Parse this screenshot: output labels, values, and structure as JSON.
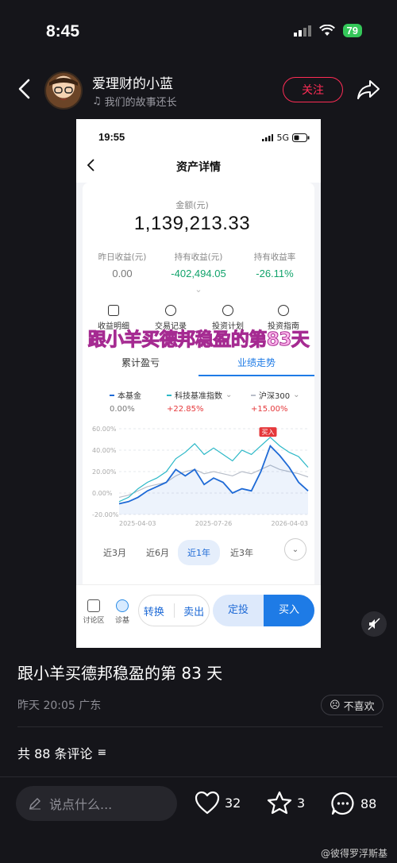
{
  "status": {
    "time": "8:45",
    "battery": "79"
  },
  "header": {
    "author": "爱理财的小蓝",
    "music": "我们的故事还长",
    "follow_label": "关注"
  },
  "screenshot": {
    "status_time": "19:55",
    "network": "5G",
    "title": "资产详情",
    "amount_label": "金额(元)",
    "amount_value": "1,139,213.33",
    "stats": [
      {
        "label": "昨日收益(元)",
        "value": "0.00"
      },
      {
        "label": "持有收益(元)",
        "value": "-402,494.05"
      },
      {
        "label": "持有收益率",
        "value": "-26.11%"
      }
    ],
    "tools": [
      "收益明细",
      "交易记录",
      "投资计划",
      "投资指南"
    ],
    "watermark": "跟小羊买德邦稳盈的第83天",
    "tabs": [
      "累计盈亏",
      "业绩走势"
    ],
    "legend": [
      {
        "name": "本基金",
        "pct": "0.00%",
        "color": "#1e6ad6"
      },
      {
        "name": "科技基准指数",
        "pct": "+22.85%",
        "color": "#2bb8c7"
      },
      {
        "name": "沪深300",
        "pct": "+15.00%",
        "color": "#b8bec9"
      }
    ],
    "ranges": [
      "近3月",
      "近6月",
      "近1年",
      "近3年"
    ],
    "bottom": {
      "discuss": "讨论区",
      "diagnose": "诊基",
      "convert": "转换",
      "sell": "卖出",
      "fixed": "定投",
      "buy": "买入"
    }
  },
  "chart_data": {
    "type": "line",
    "x": [
      "2025-04-03",
      "2025-07-26",
      "2026-04-03"
    ],
    "yticks": [
      "60.00%",
      "40.00%",
      "20.00%",
      "0.00%",
      "-20.00%"
    ],
    "ylim": [
      -20,
      60
    ],
    "annotation": "买入",
    "series": [
      {
        "name": "本基金",
        "values": [
          -10,
          -8,
          -4,
          2,
          6,
          10,
          22,
          16,
          22,
          8,
          14,
          10,
          0,
          4,
          2,
          20,
          44,
          35,
          24,
          10,
          2
        ]
      },
      {
        "name": "科技基准指数",
        "values": [
          -8,
          -4,
          4,
          10,
          14,
          20,
          32,
          38,
          46,
          36,
          42,
          36,
          30,
          40,
          36,
          44,
          52,
          44,
          38,
          34,
          24
        ]
      },
      {
        "name": "沪深300",
        "values": [
          -4,
          -2,
          2,
          6,
          8,
          10,
          16,
          20,
          22,
          18,
          20,
          18,
          16,
          20,
          18,
          22,
          26,
          22,
          20,
          18,
          15
        ]
      }
    ]
  },
  "post": {
    "title": "跟小羊买德邦稳盈的第 83 天",
    "meta": "昨天 20:05 广东",
    "dislike": "不喜欢",
    "comments_count": "共 88 条评论",
    "input_placeholder": "说点什么...",
    "likes": "32",
    "stars": "3",
    "comments": "88",
    "source": "@彼得罗浮斯基"
  }
}
